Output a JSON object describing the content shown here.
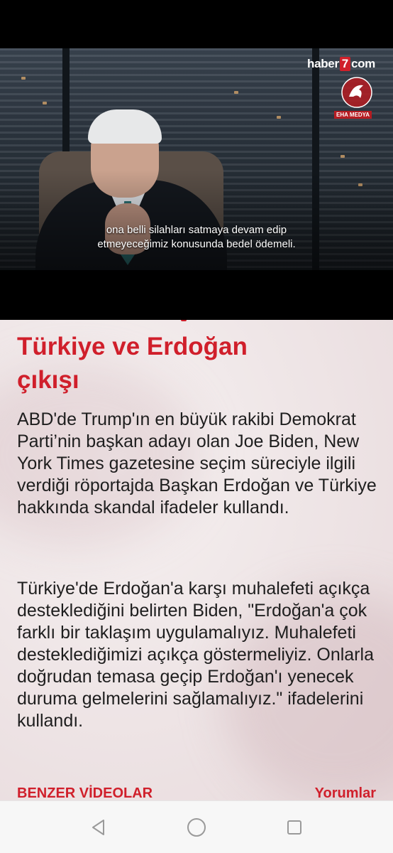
{
  "video": {
    "watermark_brand_left": "haber",
    "watermark_brand_seven": "7",
    "watermark_brand_right": "com",
    "watermark_caption": "EHA MEDYA",
    "subtitle_line1": "ona belli silahları satmaya devam edip",
    "subtitle_line2": "etmeyeceğimiz konusunda bedel ödemeli."
  },
  "article": {
    "headline_line1": "Türkiye ve Erdoğan",
    "headline_line2": "çıkışı",
    "paragraph1": "ABD'de Trump'ın en büyük rakibi Demokrat Parti’nin başkan adayı olan Joe Biden,  New York Times gazetesine seçim süreciyle ilgili verdiği röportajda Başkan Erdoğan ve Türkiye hakkında skandal ifadeler kullandı.",
    "paragraph2": "Türkiye'de Erdoğan'a karşı muhalefeti açıkça desteklediğini belirten Biden, \"Erdoğan'a çok farklı bir taklaşım uygulamalıyız. Muhalefeti desteklediğimizi açıkça göstermeliyiz. Onlarla doğrudan temasa geçip Erdoğan'ı yenecek duruma gelmelerini sağlamalıyız.\" ifadelerini kullandı."
  },
  "footer_links": {
    "related_videos": "BENZER VİDEOLAR",
    "comments": "Yorumlar"
  },
  "navbar": {
    "back_icon": "triangle-back-icon",
    "home_icon": "circle-home-icon",
    "recents_icon": "square-recents-icon",
    "icon_color": "#9a9a9a"
  },
  "colors": {
    "accent": "#d01f2b",
    "text": "#1e1e1e"
  }
}
